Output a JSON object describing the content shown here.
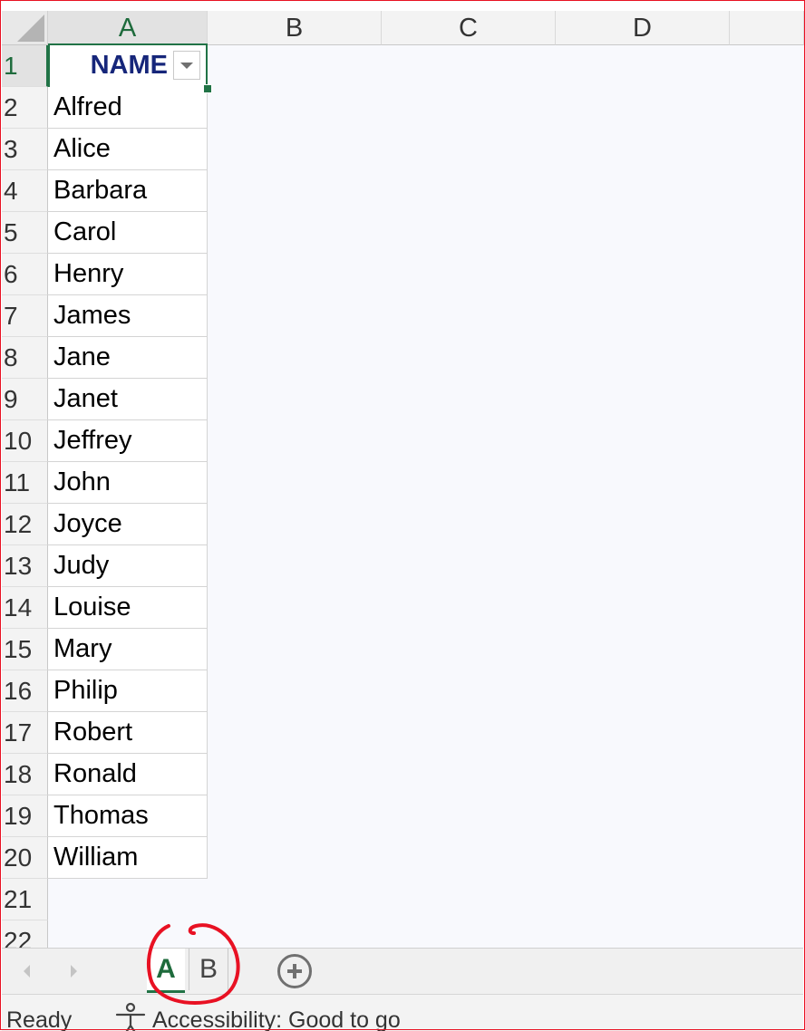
{
  "columns": [
    "A",
    "B",
    "C",
    "D"
  ],
  "active_column": "A",
  "rows": [
    "1",
    "2",
    "3",
    "4",
    "5",
    "6",
    "7",
    "8",
    "9",
    "10",
    "11",
    "12",
    "13",
    "14",
    "15",
    "16",
    "17",
    "18",
    "19",
    "20",
    "21",
    "22"
  ],
  "header_cell": "NAME",
  "names": [
    "Alfred",
    "Alice",
    "Barbara",
    "Carol",
    "Henry",
    "James",
    "Jane",
    "Janet",
    "Jeffrey",
    "John",
    "Joyce",
    "Judy",
    "Louise",
    "Mary",
    "Philip",
    "Robert",
    "Ronald",
    "Thomas",
    "William"
  ],
  "sheet_tabs": [
    {
      "label": "A",
      "active": true
    },
    {
      "label": "B",
      "active": false
    }
  ],
  "status": {
    "ready": "Ready",
    "accessibility": "Accessibility: Good to go"
  },
  "icons": {
    "filter": "filter-dropdown-icon",
    "add_sheet": "plus-circle-icon",
    "accessibility": "accessibility-person-icon"
  },
  "colors": {
    "accent": "#217346",
    "header_text": "#16267a",
    "annotation": "#e81123"
  }
}
